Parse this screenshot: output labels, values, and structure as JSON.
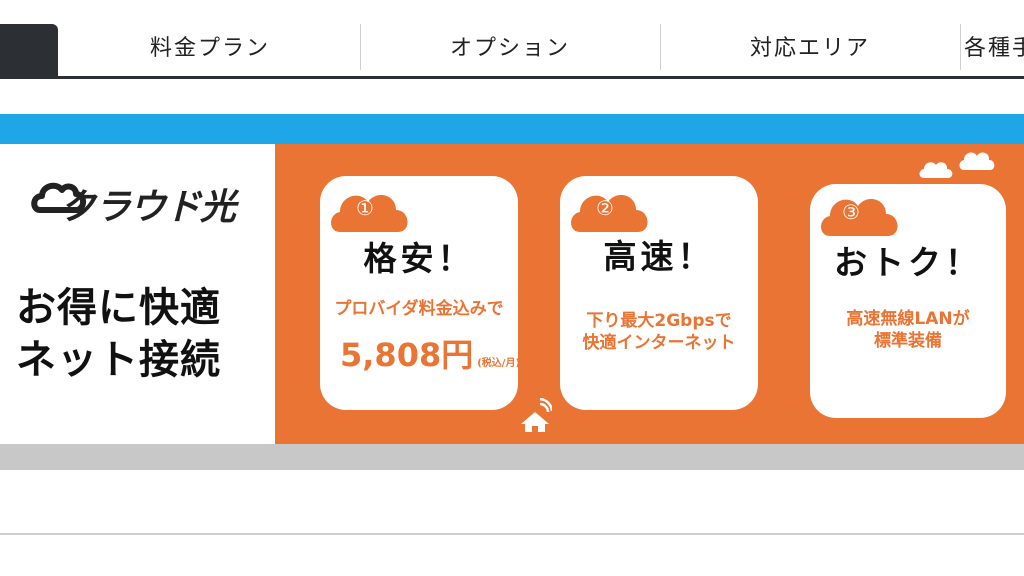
{
  "nav": {
    "items": [
      {
        "label": "料金プラン"
      },
      {
        "label": "オプション"
      },
      {
        "label": "対応エリア"
      },
      {
        "label": "各種手"
      }
    ]
  },
  "hero": {
    "logo_text": "クラウド光",
    "headline_line1": "お得に快適",
    "headline_line2": "ネット接続"
  },
  "cards": [
    {
      "number": "①",
      "title": "格安！",
      "desc_line1": "プロバイダ料金込みで",
      "price": "5,808円",
      "price_note": "(税込/月)"
    },
    {
      "number": "②",
      "title": "高速！",
      "desc_line1": "下り最大2Gbpsで",
      "desc_line2": "快適インターネット"
    },
    {
      "number": "③",
      "title": "おトク！",
      "desc_line1": "高速無線LANが",
      "desc_line2": "標準装備"
    }
  ],
  "colors": {
    "accent_orange": "#ea7434",
    "accent_blue": "#1ea6e6",
    "nav_dark": "#2c2f33"
  }
}
